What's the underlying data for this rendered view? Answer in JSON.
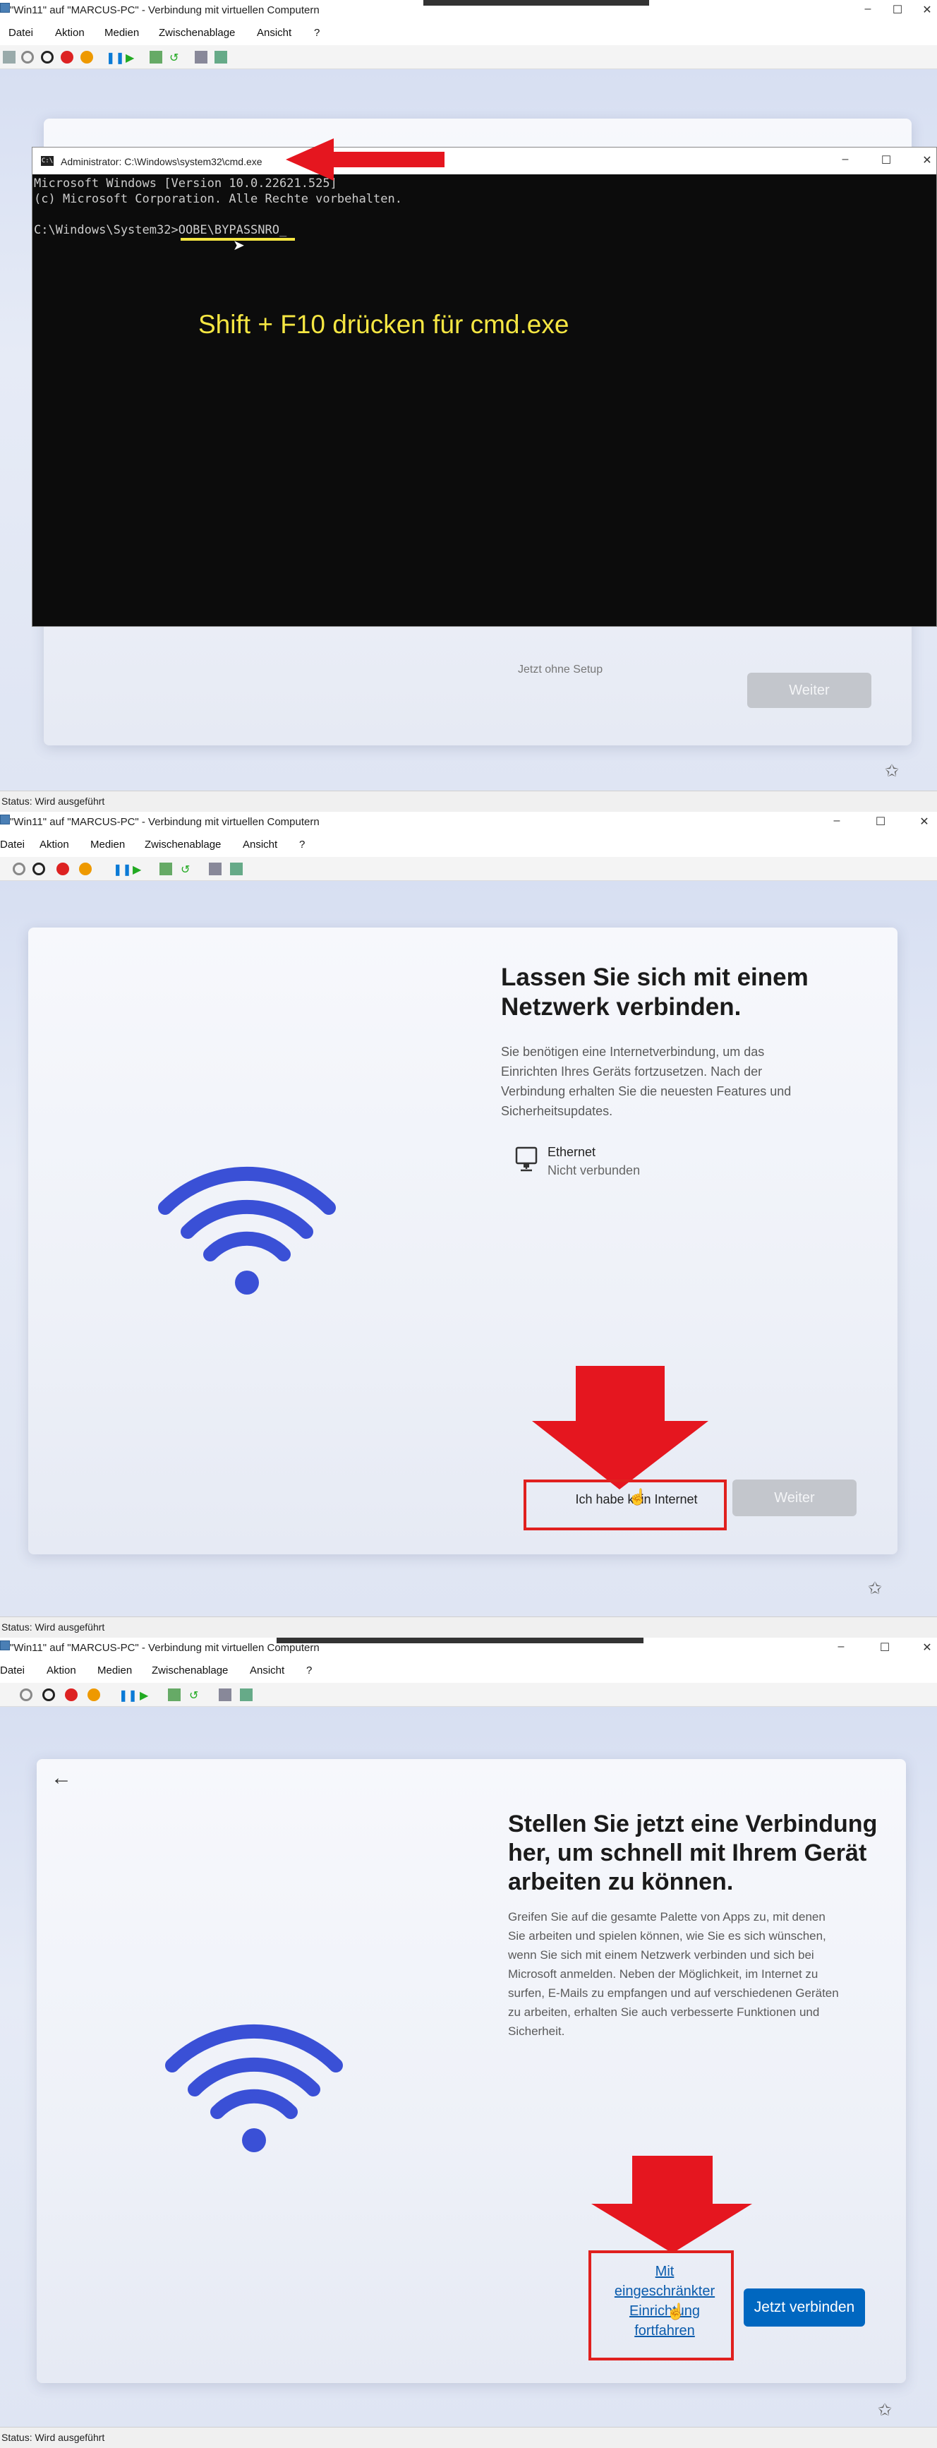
{
  "panels": [
    {
      "window_title": "\"Win11\" auf \"MARCUS-PC\" - Verbindung mit virtuellen Computern",
      "menu": [
        "Datei",
        "Aktion",
        "Medien",
        "Zwischenablage",
        "Ansicht",
        "?"
      ],
      "cmd": {
        "title": "Administrator: C:\\Windows\\system32\\cmd.exe",
        "lines": [
          "Microsoft Windows [Version 10.0.22621.525]",
          "(c) Microsoft Corporation. Alle Rechte vorbehalten.",
          ""
        ],
        "prompt": "C:\\Windows\\System32>",
        "command": "OOBE\\BYPASSNRO",
        "annotation": "Shift + F10 drücken für cmd.exe"
      },
      "behind_text": "Jetzt ohne Setup",
      "next_button": "Weiter",
      "status": "Status: Wird ausgeführt"
    },
    {
      "window_title": "\"Win11\" auf \"MARCUS-PC\" - Verbindung mit virtuellen Computern",
      "menu": [
        "Datei",
        "Aktion",
        "Medien",
        "Zwischenablage",
        "Ansicht",
        "?"
      ],
      "heading": "Lassen Sie sich mit einem Netzwerk verbinden.",
      "heading_lines": [
        "Lassen Sie sich mit einem",
        "Netzwerk verbinden."
      ],
      "description_lines": [
        "Sie benötigen eine Internetverbindung, um das",
        "Einrichten Ihres Geräts fortzusetzen. Nach der",
        "Verbindung erhalten Sie die neuesten Features und",
        "Sicherheitsupdates."
      ],
      "network": {
        "name": "Ethernet",
        "status": "Nicht verbunden"
      },
      "no_internet_button": "Ich habe kein Internet",
      "next_button": "Weiter",
      "status": "Status: Wird ausgeführt"
    },
    {
      "window_title": "\"Win11\" auf \"MARCUS-PC\" - Verbindung mit virtuellen Computern",
      "menu": [
        "Datei",
        "Aktion",
        "Medien",
        "Zwischenablage",
        "Ansicht",
        "?"
      ],
      "heading_lines": [
        "Stellen Sie jetzt eine Verbindung",
        "her, um schnell mit Ihrem Gerät",
        "arbeiten zu können."
      ],
      "description_lines": [
        "Greifen Sie auf die gesamte Palette von Apps zu, mit denen",
        "Sie arbeiten und spielen können, wie Sie es sich wünschen,",
        "wenn Sie sich mit einem Netzwerk verbinden und sich bei",
        "Microsoft anmelden. Neben der Möglichkeit, im Internet zu",
        "surfen, E-Mails zu empfangen und auf verschiedenen Geräten",
        "zu arbeiten, erhalten Sie auch verbesserte Funktionen und",
        "Sicherheit."
      ],
      "limited_link_lines": [
        "Mit",
        "eingeschränkter",
        "Einrichtung",
        "fortfahren"
      ],
      "connect_button": "Jetzt verbinden",
      "status": "Status: Wird ausgeführt"
    }
  ],
  "colors": {
    "accent": "#0067c0",
    "red": "#e5161f",
    "annotation": "#f5e642",
    "wifi": "#3a50d6"
  }
}
